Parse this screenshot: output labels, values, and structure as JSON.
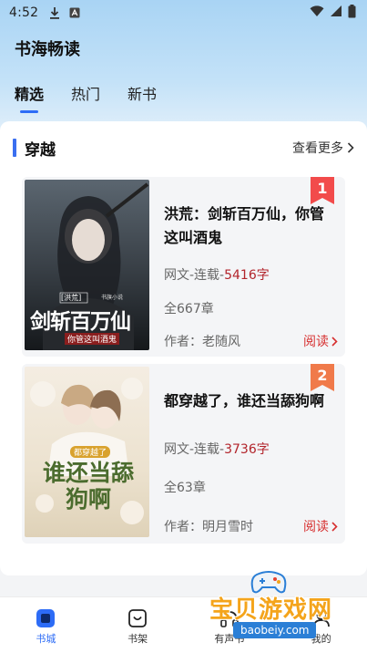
{
  "status_bar": {
    "time": "4:52",
    "icons": [
      "download-icon",
      "app-notification-icon",
      "wifi-icon",
      "signal-icon",
      "battery-icon"
    ]
  },
  "app": {
    "title": "书海畅读"
  },
  "tabs": [
    {
      "label": "精选",
      "active": true
    },
    {
      "label": "热门",
      "active": false
    },
    {
      "label": "新书",
      "active": false
    }
  ],
  "section": {
    "title": "穿越",
    "more_label": "查看更多"
  },
  "books": [
    {
      "rank": "1",
      "title": "洪荒：剑斩百万仙，你管这叫酒鬼",
      "genre": "网文-连载-",
      "word_count": "5416字",
      "chapters": "全667章",
      "author_label": "作者：老随风",
      "read_label": "阅读",
      "cover": {
        "tag": "[洪荒]",
        "main_text": "剑斩百万仙",
        "sub_text": "你管这叫酒鬼",
        "brand": "书旗小说"
      }
    },
    {
      "rank": "2",
      "title": "都穿越了，谁还当舔狗啊",
      "genre": "网文-连载-",
      "word_count": "3736字",
      "chapters": "全63章",
      "author_label": "作者：明月雪时",
      "read_label": "阅读",
      "cover": {
        "tag": "都穿越了",
        "main_text": "谁还当舔狗啊"
      }
    }
  ],
  "bottom_nav": [
    {
      "label": "书城",
      "icon": "bookstore-icon",
      "active": true
    },
    {
      "label": "书架",
      "icon": "bookshelf-icon",
      "active": false
    },
    {
      "label": "有声书",
      "icon": "audiobook-icon",
      "active": false
    },
    {
      "label": "我的",
      "icon": "profile-icon",
      "active": false
    }
  ],
  "watermark": {
    "title": "宝贝游戏网",
    "url": "baobeiy.com"
  },
  "colors": {
    "accent": "#2d6cf6",
    "word_count": "#b2242b",
    "read_link": "#d62f2f",
    "rank_badge": "#f24b4b",
    "rank_badge_2": "#f07a4a"
  }
}
